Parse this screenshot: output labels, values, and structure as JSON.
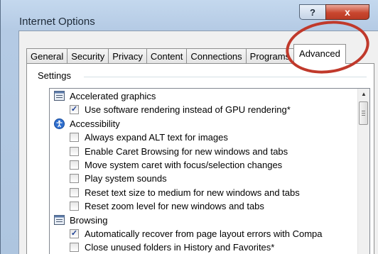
{
  "window": {
    "title": "Internet Options",
    "help_label": "?",
    "close_label": "x"
  },
  "tabs": [
    {
      "label": "General"
    },
    {
      "label": "Security"
    },
    {
      "label": "Privacy"
    },
    {
      "label": "Content"
    },
    {
      "label": "Connections"
    },
    {
      "label": "Programs"
    },
    {
      "label": "Advanced",
      "active": true
    }
  ],
  "settings": {
    "section_label": "Settings",
    "rows": [
      {
        "type": "group",
        "icon": "settings-folder-icon",
        "label": "Accelerated graphics"
      },
      {
        "type": "item",
        "checked": true,
        "label": "Use software rendering instead of GPU rendering*"
      },
      {
        "type": "group",
        "icon": "accessibility-icon",
        "label": "Accessibility"
      },
      {
        "type": "item",
        "checked": false,
        "label": "Always expand ALT text for images"
      },
      {
        "type": "item",
        "checked": false,
        "label": "Enable Caret Browsing for new windows and tabs"
      },
      {
        "type": "item",
        "checked": false,
        "label": "Move system caret with focus/selection changes"
      },
      {
        "type": "item",
        "checked": false,
        "label": "Play system sounds"
      },
      {
        "type": "item",
        "checked": false,
        "label": "Reset text size to medium for new windows and tabs"
      },
      {
        "type": "item",
        "checked": false,
        "label": "Reset zoom level for new windows and tabs"
      },
      {
        "type": "group",
        "icon": "settings-folder-icon",
        "label": "Browsing"
      },
      {
        "type": "item",
        "checked": true,
        "label": "Automatically recover from page layout errors with Compa"
      },
      {
        "type": "item",
        "checked": false,
        "label": "Close unused folders in History and Favorites*"
      }
    ]
  },
  "scrollbar": {
    "up_icon": "arrow-up-icon"
  },
  "colors": {
    "annotation": "#c0392b",
    "close_button": "#c9472f",
    "title_bar": "#c4d8ee"
  }
}
